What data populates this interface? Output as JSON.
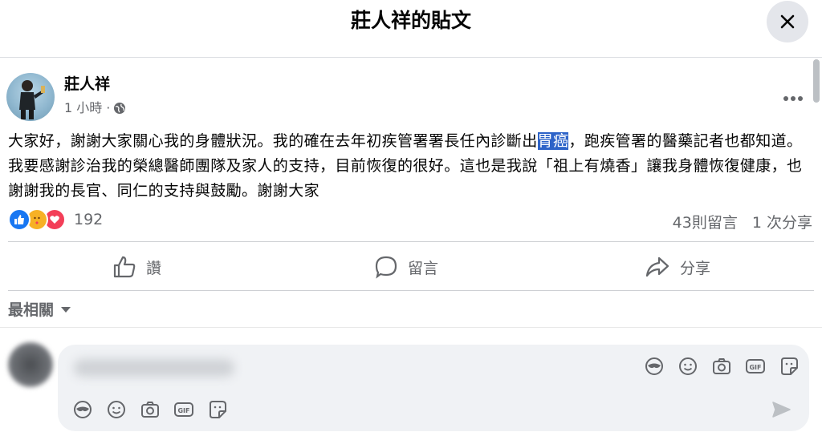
{
  "dialog": {
    "title": "莊人祥的貼文"
  },
  "post": {
    "author": "莊人祥",
    "time": "1 小時",
    "separator": "·",
    "text_before": "大家好，謝謝大家關心我的身體狀況。我的確在去年初疾管署署長任內診斷出",
    "text_highlight": "胃癌",
    "text_after": "，跑疾管署的醫藥記者也都知道。我要感謝診治我的榮總醫師團隊及家人的支持，目前恢復的很好。這也是我說「祖上有燒香」讓我身體恢復健康，也謝謝我的長官、同仁的支持與鼓勵。謝謝大家",
    "highlight_color": "#2d63c8"
  },
  "reactions": {
    "icons": [
      "like-icon",
      "care-icon",
      "love-icon"
    ],
    "count": "192",
    "comments": "43則留言",
    "shares": "1 次分享"
  },
  "actions": {
    "like": "讚",
    "comment": "留言",
    "share": "分享"
  },
  "comments_section": {
    "sort_label": "最相關"
  },
  "colors": {
    "accent": "#1877f2",
    "secondary_text": "#65676b",
    "divider": "#ced0d4",
    "input_bg": "#f0f2f5"
  }
}
